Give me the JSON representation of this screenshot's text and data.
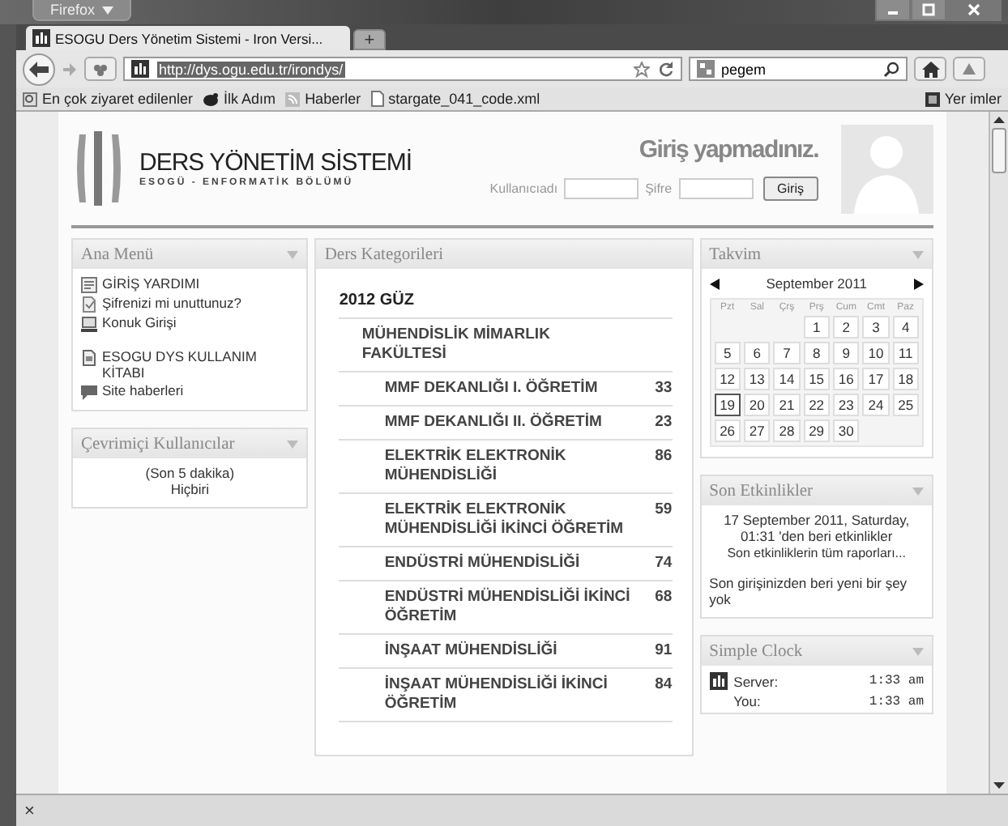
{
  "browser": {
    "menu_button": "Firefox",
    "tabs": [
      {
        "title": "ESOGU Ders Yönetim Sistemi - Iron Versi...",
        "selected": true
      }
    ],
    "new_tab": "+",
    "address": "http://dys.ogu.edu.tr/irondys/",
    "search": "pegem",
    "bookmarks": [
      {
        "label": "En çok ziyaret edilenler",
        "kind": "history"
      },
      {
        "label": "İlk Adım",
        "kind": "paw"
      },
      {
        "label": "Haberler",
        "kind": "feed"
      },
      {
        "label": "stargate_041_code.xml",
        "kind": "file"
      }
    ],
    "bookmarks_right": "Yer imler",
    "status_close": "×"
  },
  "header": {
    "title": "DERS YÖNETİM SİSTEMİ",
    "subtitle": "ESOGÜ - ENFORMATİK BÖLÜMÜ",
    "login_status": "Giriş yapmadınız.",
    "username_label": "Kullanıcıadı",
    "password_label": "Şifre",
    "login_button": "Giriş"
  },
  "main_menu": {
    "title": "Ana Menü",
    "groups": [
      [
        {
          "label": "GİRİŞ YARDIMI",
          "kind": "doc"
        },
        {
          "label": "Şifrenizi mi unuttunuz?",
          "kind": "page"
        },
        {
          "label": "Konuk Girişi",
          "kind": "guest"
        }
      ],
      [
        {
          "label": "ESOGU DYS KULLANIM KİTABI",
          "kind": "pdf"
        },
        {
          "label": "Site haberleri",
          "kind": "news"
        }
      ]
    ]
  },
  "online_users": {
    "title": "Çevrimiçi Kullanıcılar",
    "period": "(Son 5 dakika)",
    "users": "Hiçbiri"
  },
  "categories": {
    "title": "Ders Kategorileri",
    "tree": [
      {
        "name": "2012 GÜZ",
        "children": [
          {
            "name": "MÜHENDİSLİK MİMARLIK FAKÜLTESİ",
            "children": [
              {
                "name": "MMF DEKANLIĞI I. ÖĞRETİM",
                "count": "33"
              },
              {
                "name": "MMF DEKANLIĞI II. ÖĞRETİM",
                "count": "23"
              },
              {
                "name": "ELEKTRİK ELEKTRONİK MÜHENDİSLİĞİ",
                "count": "86"
              },
              {
                "name": "ELEKTRİK ELEKTRONİK MÜHENDİSLİĞİ İKİNCİ ÖĞRETİM",
                "count": "59"
              },
              {
                "name": "ENDÜSTRİ MÜHENDİSLİĞİ",
                "count": "74"
              },
              {
                "name": "ENDÜSTRİ MÜHENDİSLİĞİ İKİNCİ ÖĞRETİM",
                "count": "68"
              },
              {
                "name": "İNŞAAT MÜHENDİSLİĞİ",
                "count": "91"
              },
              {
                "name": "İNŞAAT MÜHENDİSLİĞİ İKİNCİ ÖĞRETİM",
                "count": "84"
              }
            ]
          }
        ]
      }
    ]
  },
  "calendar": {
    "title": "Takvim",
    "month": "September 2011",
    "weekdays": [
      "Pzt",
      "Sal",
      "Çrş",
      "Prş",
      "Cum",
      "Cmt",
      "Paz"
    ],
    "weeks": [
      [
        {
          "day": "1",
          "today": false
        },
        {
          "day": "2",
          "today": false
        },
        {
          "day": "3",
          "today": false
        },
        {
          "day": "4",
          "today": false
        }
      ],
      [
        {
          "day": "5",
          "today": false
        },
        {
          "day": "6",
          "today": false
        },
        {
          "day": "7",
          "today": false
        },
        {
          "day": "8",
          "today": false
        },
        {
          "day": "9",
          "today": false
        },
        {
          "day": "10",
          "today": false
        },
        {
          "day": "11",
          "today": false
        }
      ],
      [
        {
          "day": "12",
          "today": false
        },
        {
          "day": "13",
          "today": false
        },
        {
          "day": "14",
          "today": false
        },
        {
          "day": "15",
          "today": false
        },
        {
          "day": "16",
          "today": false
        },
        {
          "day": "17",
          "today": false
        },
        {
          "day": "18",
          "today": false
        }
      ],
      [
        {
          "day": "19",
          "today": true
        },
        {
          "day": "20",
          "today": false
        },
        {
          "day": "21",
          "today": false
        },
        {
          "day": "22",
          "today": false
        },
        {
          "day": "23",
          "today": false
        },
        {
          "day": "24",
          "today": false
        },
        {
          "day": "25",
          "today": false
        }
      ],
      [
        {
          "day": "26",
          "today": false
        },
        {
          "day": "27",
          "today": false
        },
        {
          "day": "28",
          "today": false
        },
        {
          "day": "29",
          "today": false
        },
        {
          "day": "30",
          "today": false
        }
      ]
    ]
  },
  "recent_activity": {
    "title": "Son Etkinlikler",
    "since": "17 September 2011, Saturday, 01:31 'den beri etkinlikler",
    "report_link": "Son etkinliklerin tüm raporları...",
    "message": "Son girişinizden beri yeni bir şey yok"
  },
  "clock": {
    "title": "Simple Clock",
    "rows": [
      {
        "label": "Server:",
        "time": "1:33 am",
        "icon": true
      },
      {
        "label": "You:",
        "time": "1:33 am",
        "icon": false
      }
    ]
  }
}
